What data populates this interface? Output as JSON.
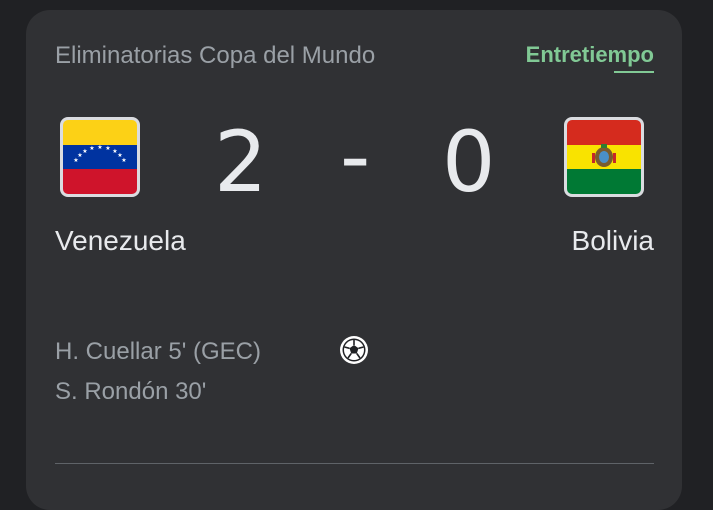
{
  "match": {
    "competition": "Eliminatorias Copa del Mundo",
    "status": "Entretiempo",
    "home": {
      "name": "Venezuela",
      "score": "2",
      "flag_icon": "venezuela-flag",
      "flag_colors": [
        "#FCD116",
        "#0033A0",
        "#CF142B"
      ]
    },
    "separator": "-",
    "away": {
      "name": "Bolivia",
      "score": "0",
      "flag_icon": "bolivia-flag",
      "flag_colors": [
        "#D52B1E",
        "#F9E300",
        "#007934"
      ]
    },
    "goals": [
      {
        "text": "H. Cuellar 5' (GEC)"
      },
      {
        "text": "S. Rondón 30'"
      }
    ],
    "goal_icon": "soccer-ball-icon"
  },
  "colors": {
    "card_bg": "#303134",
    "page_bg": "#202124",
    "status": "#81c995",
    "primary_text": "#e8eaed",
    "secondary_text": "#9aa0a6"
  }
}
